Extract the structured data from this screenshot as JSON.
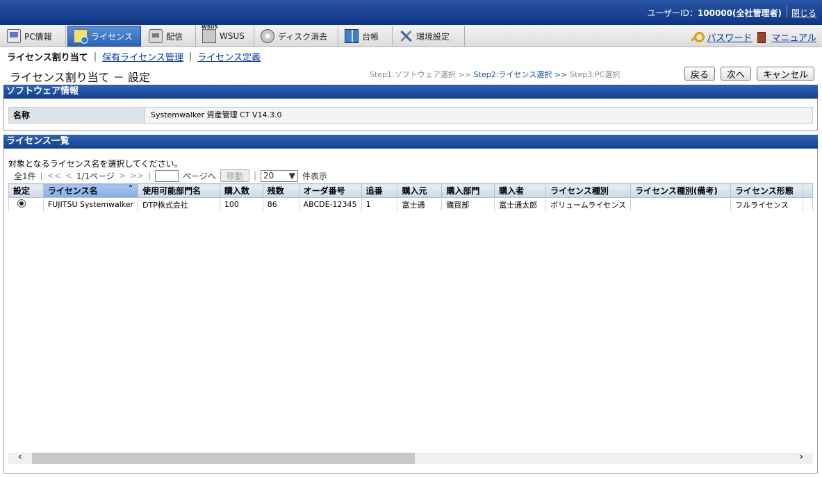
{
  "header": {
    "user_label": "ユーザーID：",
    "user_value": "100000(全社管理者)",
    "close_label": "閉じる"
  },
  "tabs": [
    {
      "label": "PC情報",
      "icon": "pc-icon"
    },
    {
      "label": "ライセンス",
      "icon": "license-icon"
    },
    {
      "label": "配信",
      "icon": "distribution-icon"
    },
    {
      "label": "WSUS",
      "icon": "wsus-icon"
    },
    {
      "label": "ディスク消去",
      "icon": "disk-erase-icon"
    },
    {
      "label": "台帳",
      "icon": "ledger-icon"
    },
    {
      "label": "環境設定",
      "icon": "settings-icon"
    }
  ],
  "toplinks": {
    "password": "パスワード",
    "manual": "マニュアル"
  },
  "subnav": {
    "current": "ライセンス割り当て",
    "link1": "保有ライセンス管理",
    "link2": "ライセンス定義"
  },
  "page": {
    "title": "ライセンス割り当て － 設定",
    "step1": "Step1:ソフトウェア選択 >>",
    "step2": "Step2:ライセンス選択 >>",
    "step3": "Step3:PC選択",
    "back": "戻る",
    "next": "次へ",
    "cancel": "キャンセル"
  },
  "software": {
    "section_title": "ソフトウェア情報",
    "name_label": "名称",
    "name_value": "Systemwalker 資産管理 CT V14.3.0"
  },
  "license_list": {
    "section_title": "ライセンス一覧",
    "prompt": "対象となるライセンス名を選択してください。",
    "total": "全1件",
    "first": "<<",
    "prev": "<",
    "page_info": "1/1ページ",
    "next": ">",
    "last": ">>",
    "page_suffix": "ページへ",
    "move": "移動",
    "per_page": "20",
    "per_page_suffix": "件表示",
    "columns": [
      "設定",
      "ライセンス名",
      "使用可能部門名",
      "購入数",
      "残数",
      "オーダ番号",
      "追番",
      "購入元",
      "購入部門",
      "購入者",
      "ライセンス種別",
      "ライセンス種別(備考)",
      "ライセンス形態"
    ],
    "rows": [
      [
        "",
        "FUJITSU Systemwalker",
        "DTP株式会社",
        "100",
        "86",
        "ABCDE-12345",
        "1",
        "富士通",
        "購買部",
        "富士通太郎",
        "ボリュームライセンス",
        "",
        "フルライセンス"
      ]
    ]
  }
}
